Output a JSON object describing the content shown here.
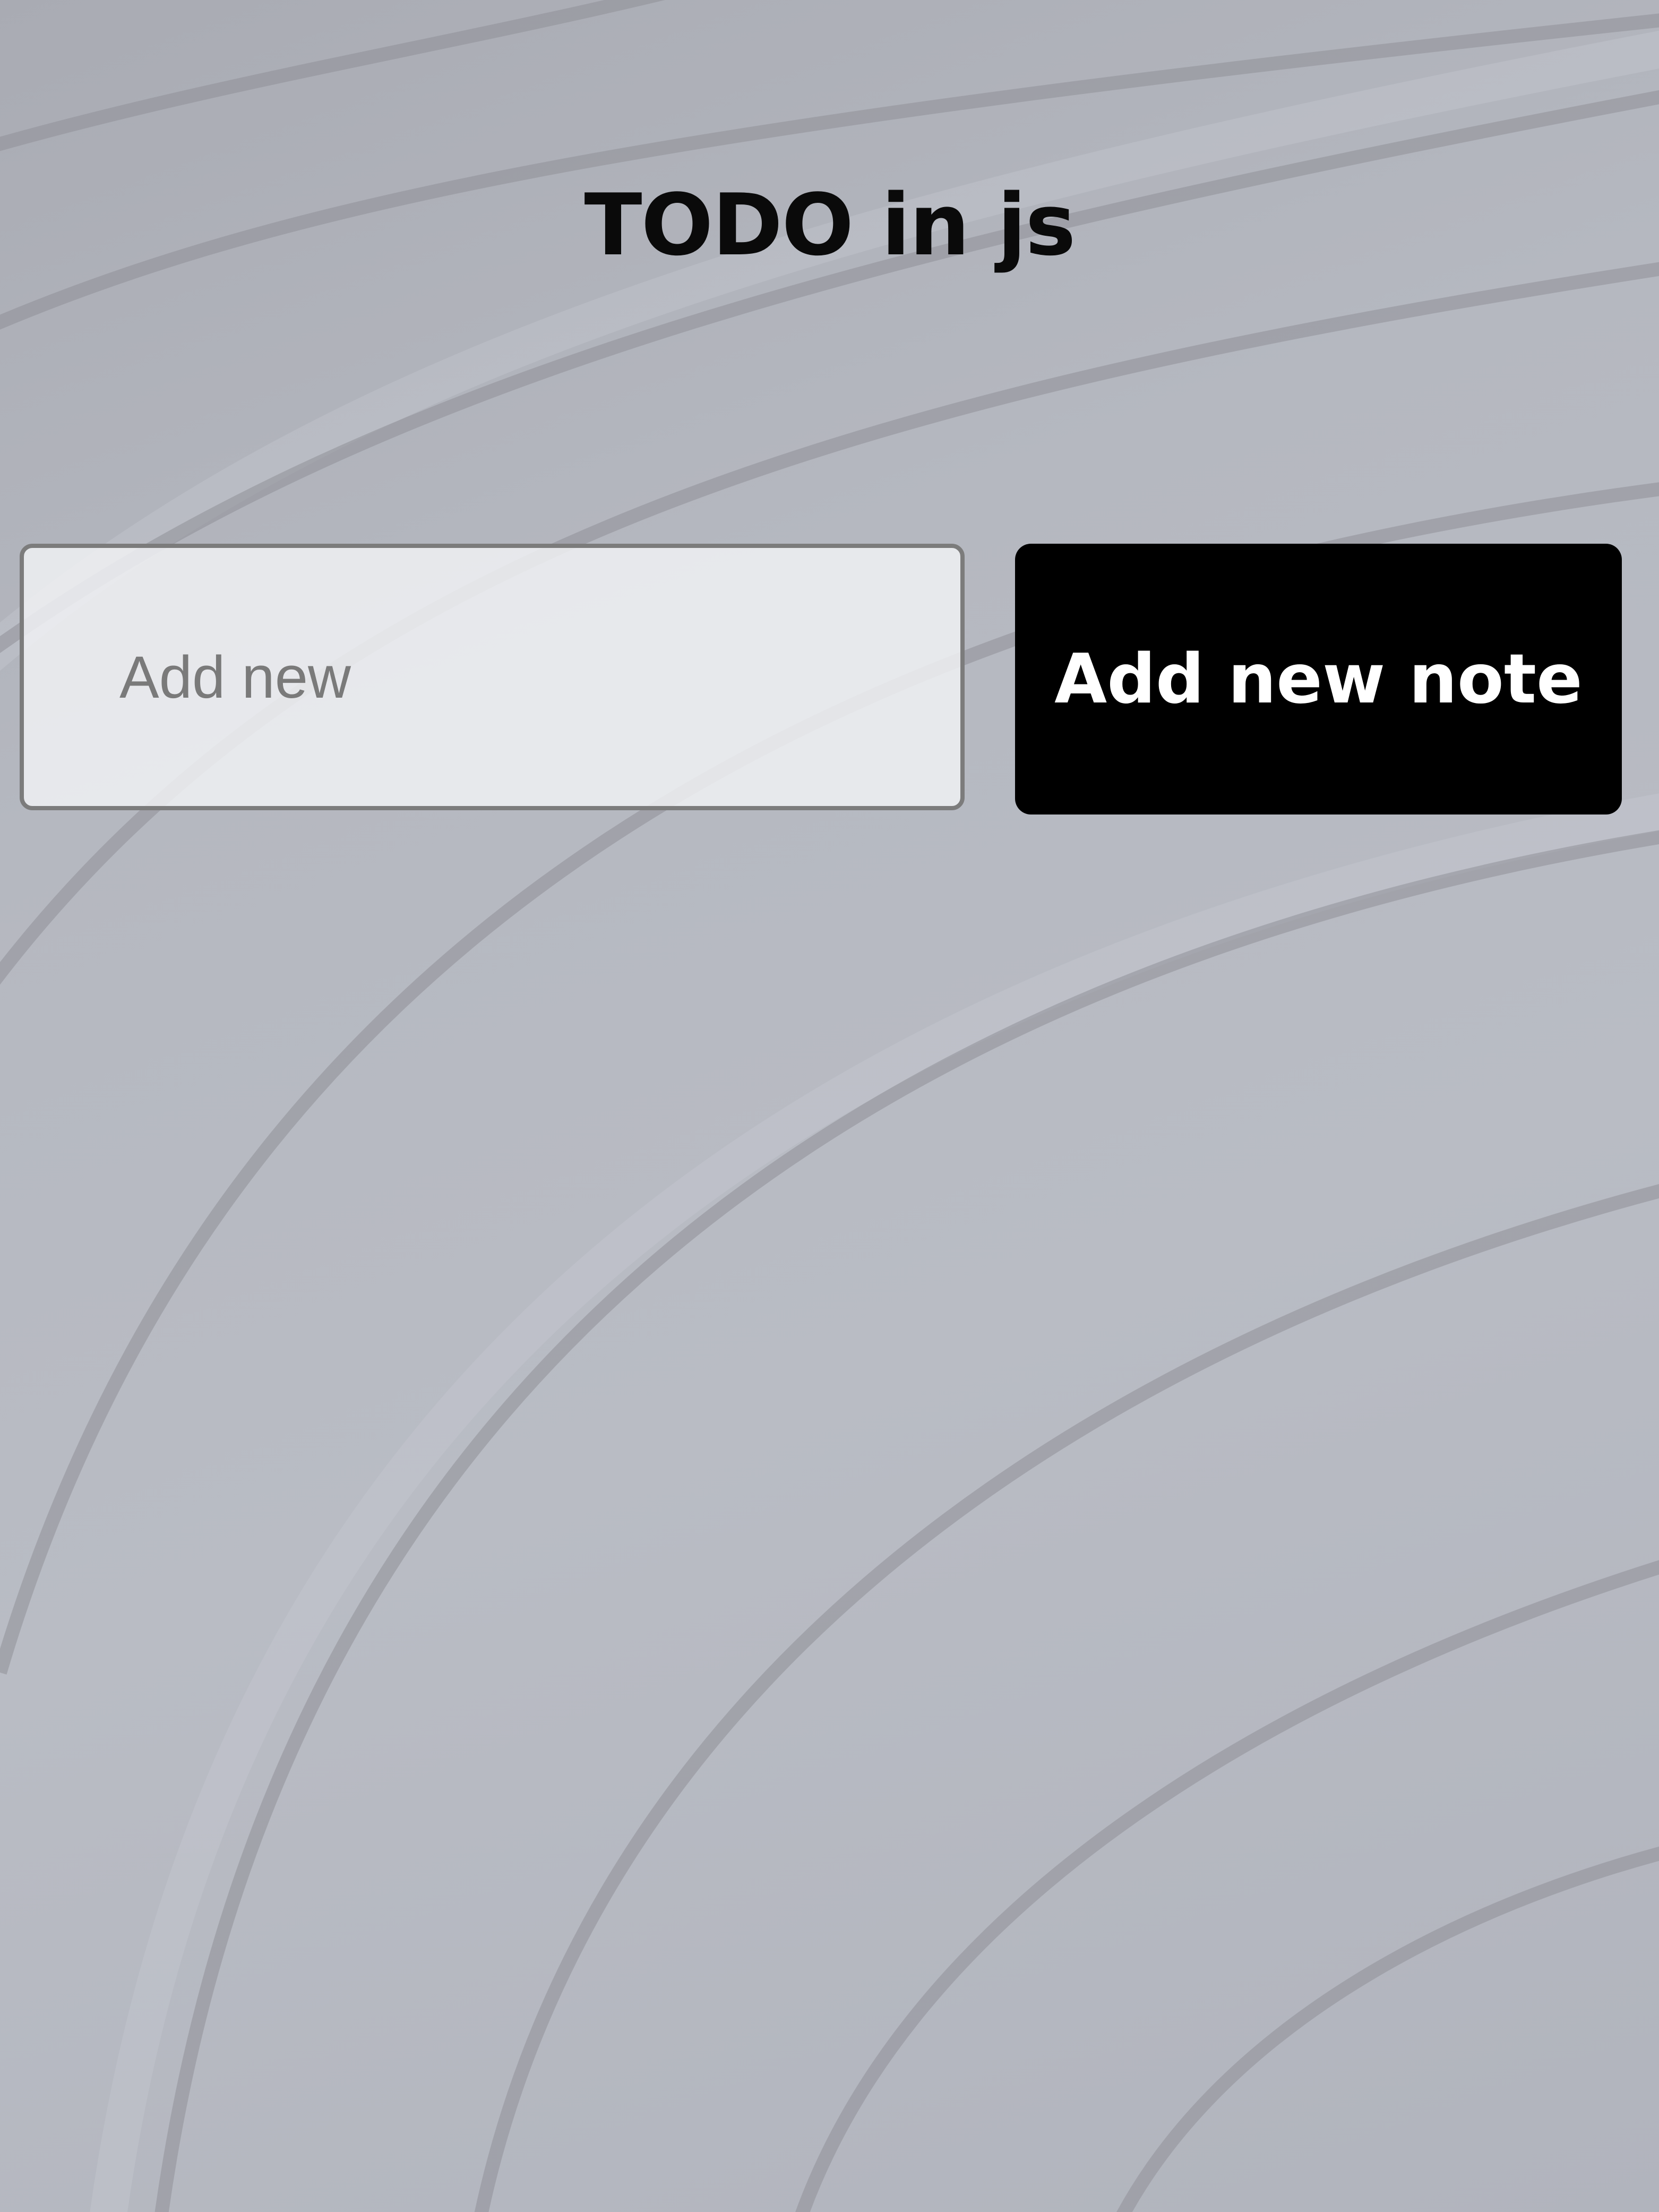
{
  "app": {
    "title": "TODO in js"
  },
  "form": {
    "input_placeholder": "Add new",
    "input_value": "",
    "add_button_label": "Add new note"
  },
  "colors": {
    "background": "#b6b9c1",
    "button_background": "#000000",
    "button_text": "#ffffff",
    "title_text": "#0a0a0a"
  }
}
